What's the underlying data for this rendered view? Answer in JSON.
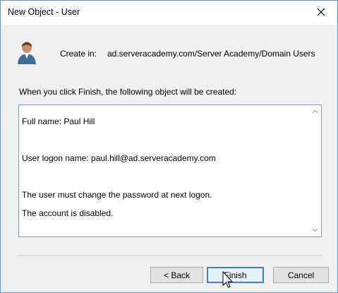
{
  "window": {
    "title": "New Object - User",
    "close_glyph": "✕"
  },
  "header": {
    "icon": "user-icon",
    "create_in_label": "Create in:",
    "create_in_path": "ad.serveracademy.com/Server Academy/Domain Users"
  },
  "body": {
    "intro": "When you click Finish, the following object will be created:",
    "summary": {
      "full_name": "Full name: Paul Hill",
      "logon_name": "User logon name: paul.hill@ad.serveracademy.com",
      "must_change_password": "The user must change the password at next logon.",
      "account_disabled": "The account is disabled."
    }
  },
  "buttons": {
    "back": "< Back",
    "finish": "Finish",
    "cancel": "Cancel"
  },
  "colors": {
    "accent": "#3c7fd1",
    "window_border": "#6f8fb5"
  }
}
